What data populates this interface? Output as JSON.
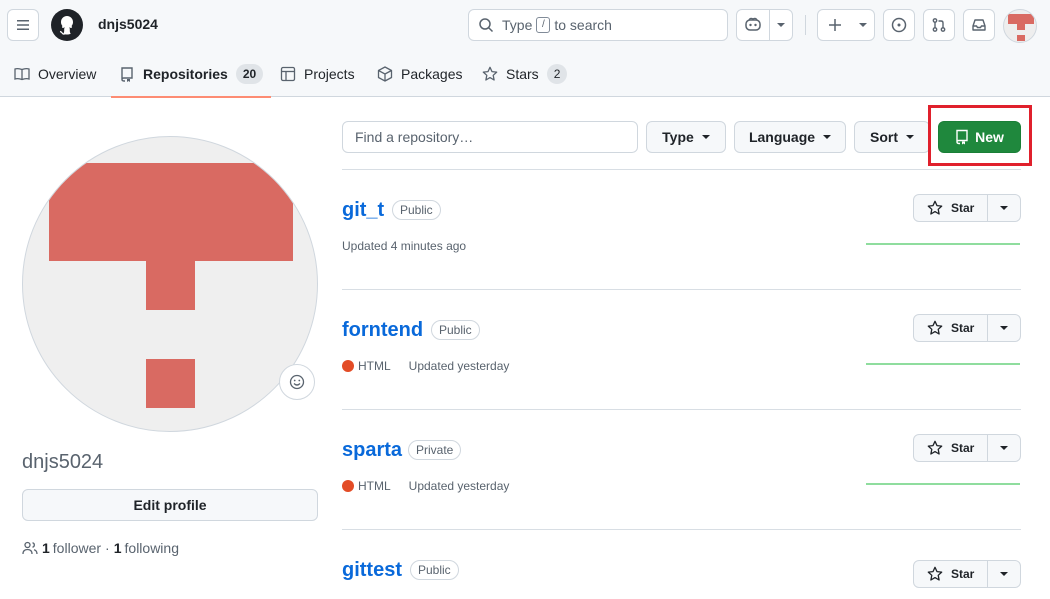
{
  "header": {
    "username": "dnjs5024",
    "search_prefix": "Type",
    "search_key": "/",
    "search_suffix": "to search",
    "icons": [
      "hamburger-icon",
      "github-logo-icon",
      "search-icon",
      "copilot-icon",
      "chevron-down-icon",
      "plus-icon",
      "issue-icon",
      "pull-request-icon",
      "inbox-icon"
    ]
  },
  "tabs": [
    {
      "label": "Overview",
      "icon": "book-icon"
    },
    {
      "label": "Repositories",
      "icon": "repo-icon",
      "count": "20",
      "active": true
    },
    {
      "label": "Projects",
      "icon": "table-icon"
    },
    {
      "label": "Packages",
      "icon": "package-icon"
    },
    {
      "label": "Stars",
      "icon": "star-icon",
      "count": "2"
    }
  ],
  "profile": {
    "name": "dnjs5024",
    "edit_label": "Edit profile",
    "followers": "1",
    "followers_label": "follower",
    "separator": "·",
    "following": "1",
    "following_label": "following",
    "avatar_color": "#d96a62"
  },
  "filters": {
    "find_placeholder": "Find a repository…",
    "type_label": "Type",
    "language_label": "Language",
    "sort_label": "Sort",
    "new_label": "New"
  },
  "repos": [
    {
      "name": "git_t",
      "visibility": "Public",
      "language": "",
      "updated": "Updated 4 minutes ago",
      "star_label": "Star"
    },
    {
      "name": "forntend",
      "visibility": "Public",
      "language": "HTML",
      "updated": "Updated yesterday",
      "star_label": "Star"
    },
    {
      "name": "sparta",
      "visibility": "Private",
      "language": "HTML",
      "updated": "Updated yesterday",
      "star_label": "Star"
    },
    {
      "name": "gittest",
      "visibility": "Public",
      "language": "",
      "updated": "",
      "star_label": "Star"
    }
  ],
  "colors": {
    "accent_green": "#1f883d",
    "link_blue": "#0969da",
    "html_lang": "#e34c26",
    "highlight_red": "#e0202c",
    "tab_underline": "#fd8c73"
  }
}
